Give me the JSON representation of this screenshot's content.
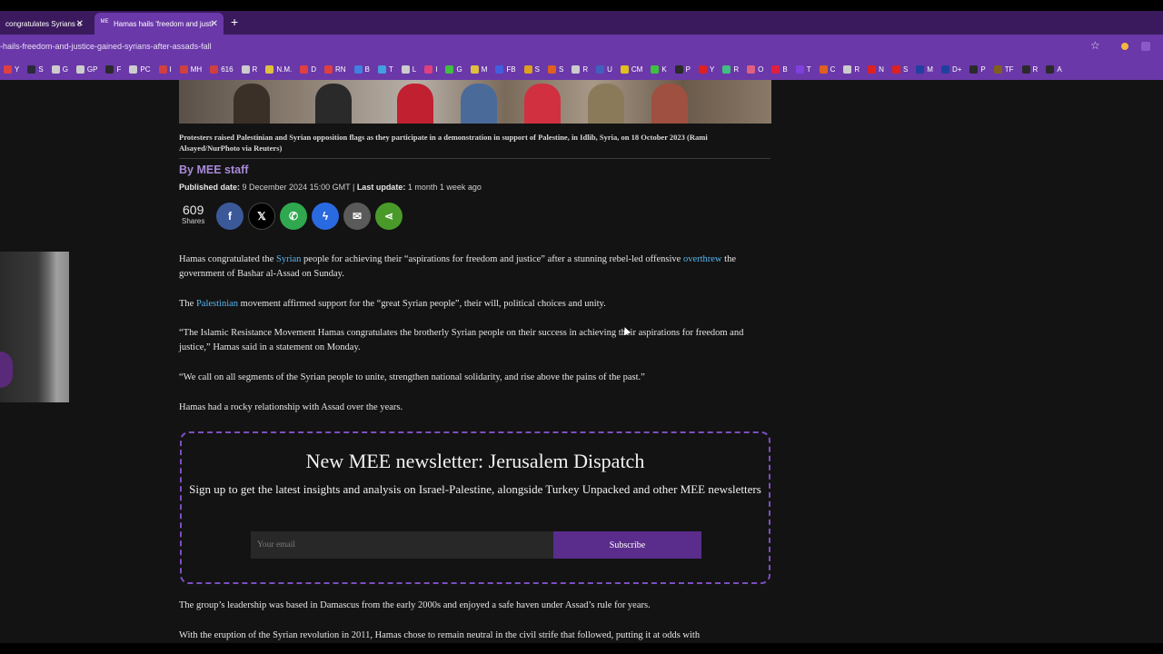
{
  "browser": {
    "tabs": [
      {
        "title": "congratulates Syrians o",
        "active": false
      },
      {
        "title": "Hamas hails 'freedom and justi",
        "active": true
      }
    ],
    "url": "-hails-freedom-and-justice-gained-syrians-after-assads-fall",
    "bookmarks": [
      {
        "label": "Y",
        "color": "#e04040"
      },
      {
        "label": "S",
        "color": "#2a2a3a"
      },
      {
        "label": "G",
        "color": "#cccccc"
      },
      {
        "label": "GP",
        "color": "#cccccc"
      },
      {
        "label": "F",
        "color": "#2a2a2a"
      },
      {
        "label": "PC",
        "color": "#cccccc"
      },
      {
        "label": "I",
        "color": "#d04040"
      },
      {
        "label": "MH",
        "color": "#d04040"
      },
      {
        "label": "616",
        "color": "#d04040"
      },
      {
        "label": "R",
        "color": "#cccccc"
      },
      {
        "label": "N.M.",
        "color": "#e0c040"
      },
      {
        "label": "D",
        "color": "#e04040"
      },
      {
        "label": "RN",
        "color": "#e04040"
      },
      {
        "label": "B",
        "color": "#4080e0"
      },
      {
        "label": "T",
        "color": "#40a0e0"
      },
      {
        "label": "L",
        "color": "#cccccc"
      },
      {
        "label": "I",
        "color": "#e04080"
      },
      {
        "label": "G",
        "color": "#40c040"
      },
      {
        "label": "M",
        "color": "#e0c040"
      },
      {
        "label": "FB",
        "color": "#4060e0"
      },
      {
        "label": "S",
        "color": "#e0a020"
      },
      {
        "label": "S",
        "color": "#e06020"
      },
      {
        "label": "R",
        "color": "#cccccc"
      },
      {
        "label": "U",
        "color": "#4060c0"
      },
      {
        "label": "CM",
        "color": "#e0c020"
      },
      {
        "label": "K",
        "color": "#40c040"
      },
      {
        "label": "P",
        "color": "#2a2a2a"
      },
      {
        "label": "Y",
        "color": "#e02020"
      },
      {
        "label": "R",
        "color": "#40c080"
      },
      {
        "label": "O",
        "color": "#e06080"
      },
      {
        "label": "B",
        "color": "#e02040"
      },
      {
        "label": "T",
        "color": "#8040e0"
      },
      {
        "label": "C",
        "color": "#e06020"
      },
      {
        "label": "R",
        "color": "#cccccc"
      },
      {
        "label": "N",
        "color": "#e02020"
      },
      {
        "label": "S",
        "color": "#e02020"
      },
      {
        "label": "M",
        "color": "#2040a0"
      },
      {
        "label": "D+",
        "color": "#2040a0"
      },
      {
        "label": "P",
        "color": "#2a2a2a"
      },
      {
        "label": "TF",
        "color": "#806020"
      },
      {
        "label": "R",
        "color": "#2a2a2a"
      },
      {
        "label": "A",
        "color": "#2a2a2a"
      }
    ]
  },
  "article": {
    "caption": "Protesters raised Palestinian and Syrian opposition flags as they participate in a demonstration in support of Palestine, in Idlib, Syria, on 18 October 2023 (Rami Alsayed/NurPhoto via Reuters)",
    "byline_prefix": "By",
    "byline_name": "MEE staff",
    "published_label": "Published date:",
    "published_value": "9 December 2024 15:00 GMT",
    "separator": "|",
    "update_label": "Last update:",
    "update_value": "1 month 1 week ago",
    "shares_count": "609",
    "shares_label": "Shares",
    "share_icons": [
      "facebook-icon",
      "x-icon",
      "whatsapp-icon",
      "messenger-icon",
      "email-icon",
      "share-icon"
    ],
    "p1_a": "Hamas congratulated the ",
    "p1_link1": "Syrian",
    "p1_b": " people for achieving their “aspirations for freedom and justice” after a stunning rebel-led offensive ",
    "p1_link2": "overthrew",
    "p1_c": " the government of Bashar al-Assad on Sunday.",
    "p2_a": "The ",
    "p2_link": "Palestinian",
    "p2_b": " movement affirmed support for the “great Syrian people”, their will, political choices and unity.",
    "p3": "“The Islamic Resistance Movement Hamas congratulates the brotherly Syrian people on their success in achieving their aspirations for freedom and justice,” Hamas said in a statement on Monday.",
    "p4": "“We call on all segments of the Syrian people to unite, strengthen national solidarity, and rise above the pains of the past.”",
    "p5": "Hamas had a rocky relationship with Assad over the years.",
    "p6": "The group’s leadership was based in Damascus from the early 2000s and enjoyed a safe haven under Assad’s rule for years.",
    "p7": "With the eruption of the Syrian revolution in 2011, Hamas chose to remain neutral in the civil strife that followed, putting it at odds with"
  },
  "newsletter": {
    "title": "New MEE newsletter: Jerusalem Dispatch",
    "subtitle": "Sign up to get the latest insights and analysis on Israel-Palestine, alongside Turkey Unpacked and other MEE newsletters",
    "email_placeholder": "Your email",
    "subscribe_label": "Subscribe"
  },
  "colors": {
    "accent": "#6a38a8",
    "link": "#56b6f0",
    "byline": "#a98ad8"
  }
}
